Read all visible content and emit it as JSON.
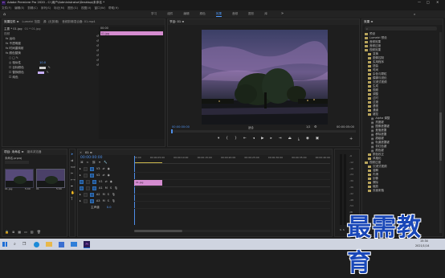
{
  "app": {
    "title": "Adobe Premiere Pro 2020 - C:\\用户\\Administrator\\Desktop\\未命名 *"
  },
  "menubar": {
    "items": [
      "文件(F)",
      "编辑(E)",
      "剪辑(C)",
      "序列(S)",
      "标记(M)",
      "图形(G)",
      "视图(V)",
      "窗口(W)",
      "帮助(H)"
    ]
  },
  "workspaces": {
    "items": [
      "学习",
      "组件",
      "编辑",
      "颜色",
      "效果",
      "音频",
      "图形",
      "库"
    ],
    "active_index": 4
  },
  "effect_controls": {
    "tabs": [
      "效果控件 ≡",
      "Lumetri 范围",
      "源: (无剪辑)",
      "音频剪辑混合器: 01.mp4"
    ],
    "clip_label": "主要 * 01.jpg",
    "seq_label": "01 * 01.jpg",
    "timecode": "00:00",
    "clip_bar": "01.jpg",
    "video_section": "视频",
    "rows": [
      "fx 运动",
      "fx 不透明度",
      "fx 时间重映射",
      "fx 颜色替换",
      "○ □ ✎",
      "◎ 相似性",
      "☐ 目标颜色",
      "☐ 替换颜色",
      "☐ 纯色"
    ],
    "similarity_value": "10.0",
    "solid_label": "纯色"
  },
  "program": {
    "tab": "节目: 01 ≡",
    "timecode_left": "00:00:00:00",
    "fit": "适合",
    "ratio": "1/2",
    "timecode_right": "00:00:05:00"
  },
  "effects": {
    "tab": "效果 ≡",
    "items": [
      "预设",
      "Lumetri 预设",
      "音频效果",
      "音频过渡",
      "视频效果",
      "变换",
      "图像控制",
      "实用程序",
      "扭曲",
      "时间",
      "杂色与颗粒",
      "模糊与锐化",
      "沉浸式视频",
      "生成",
      "视频",
      "调整",
      "过时",
      "过渡",
      "透视",
      "通道",
      "键控",
      "Alpha 调整",
      "亮度键",
      "图像遮罩键",
      "差值遮罩",
      "移除遮罩",
      "超级键",
      "轨道遮罩键",
      "非红色键",
      "颜色键",
      "颜色校正",
      "风格化",
      "视频过渡",
      "沉浸式视频",
      "溶解",
      "内滑",
      "划像",
      "擦除",
      "缩放",
      "页面剥落"
    ],
    "scroll_fraction": 0.55
  },
  "project": {
    "tabs": [
      "项目: 未命名 ≡",
      "媒体浏览器"
    ],
    "file_label": "未命名.prproj",
    "thumbs": [
      {
        "name": "01.jpg",
        "duration": "5:00"
      },
      {
        "name": "01",
        "duration": "5:00"
      }
    ]
  },
  "timeline": {
    "tab": "01 ≡",
    "timecode": "00:00:00:00",
    "ruler": [
      "00:00",
      "00:00:05:00",
      "00:00:10:00",
      "00:00:15:00",
      "00:00:20:00",
      "00:00:25:00",
      "00:00:30:00",
      "00:00:35:00",
      "00:00:40:00"
    ],
    "tracks": [
      "V3",
      "V2",
      "V1",
      "A1",
      "A2",
      "A3"
    ],
    "master_label": "主声道",
    "master_value": "0.0",
    "clip_label": "01.jpg"
  },
  "meter": {
    "labels": [
      "-6",
      "-12",
      "-18",
      "-24",
      "-30",
      "-36",
      "-42",
      "-48",
      "-54",
      "dB"
    ],
    "footer": [
      "S",
      "S"
    ]
  },
  "taskbar": {
    "search_icon": "search-icon",
    "apps": [
      "edge-icon",
      "explorer-icon",
      "store-icon",
      "mail-icon",
      "premiere-icon"
    ],
    "time": "15:34",
    "date": "2021/1/14"
  },
  "watermark": {
    "text": "最需教育"
  },
  "colors": {
    "accent": "#2d8ceb",
    "clip_pink": "#d58cd0",
    "bg": "#1d1d1d",
    "timecode_blue": "#4e8ee8"
  }
}
